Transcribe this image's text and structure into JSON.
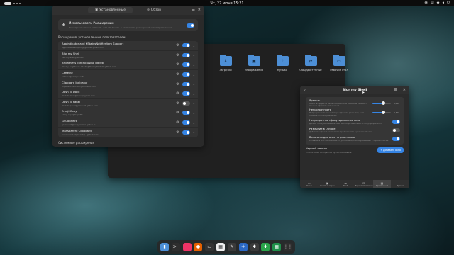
{
  "topbar": {
    "clock": "Чт, 27 июня 15:21"
  },
  "extensions_window": {
    "tabs": [
      {
        "label": "Установленные"
      },
      {
        "label": "Обзор"
      }
    ],
    "use_extensions": {
      "title": "Использовать Расширения",
      "subtitle": "Расширения можно включить или отключить в настройках расширений или в приложении…"
    },
    "user_section": "Расширения, установленные пользователем",
    "items": [
      {
        "title": "AppIndicator and KStatusNotifierItem Support",
        "subtitle": "appindicatorsupport@rgcjonas.gmail.com",
        "enabled": true
      },
      {
        "title": "Blur my Shell",
        "subtitle": "blur-my-shell@aunetx",
        "enabled": true
      },
      {
        "title": "Brightness control using ddcutil",
        "subtitle": "display-brightness-ddcutil@themightydeity.github.com",
        "enabled": true
      },
      {
        "title": "Caffeine",
        "subtitle": "caffeine@patapon.info",
        "enabled": true
      },
      {
        "title": "Clipboard Indicator",
        "subtitle": "clipboard-indicator@tudmotu.com",
        "enabled": true
      },
      {
        "title": "Dash to Dock",
        "subtitle": "dash-to-dock@micxgx.gmail.com",
        "enabled": true
      },
      {
        "title": "Dash to Panel",
        "subtitle": "dash-to-panel@jderose9.github.com",
        "enabled": false
      },
      {
        "title": "Emoji Copy",
        "subtitle": "emoji-copy@felipeftn",
        "enabled": true
      },
      {
        "title": "GSConnect",
        "subtitle": "gsconnect@andyholmes.github.io",
        "enabled": true
      },
      {
        "title": "Transparent Clipboard",
        "subtitle": "transparent-clipboard@...github.com",
        "enabled": true
      }
    ],
    "system_section": "Системные расширения"
  },
  "files_window": {
    "folders": [
      {
        "label": "Загрузки",
        "icon": "download-icon"
      },
      {
        "label": "Изображения",
        "icon": "image-icon"
      },
      {
        "label": "Музыка",
        "icon": "music-icon"
      },
      {
        "label": "Общедоступные",
        "icon": "share-icon"
      },
      {
        "label": "Рабочий стол",
        "icon": "desktop-icon"
      }
    ]
  },
  "blur_window": {
    "title": "Blur my Shell",
    "options": [
      {
        "title": "Яркость",
        "subtitle": "Яркость эффекта размытия, высокое значение означает меньше эффекта затемнения.",
        "control": "slider",
        "value": 0.6,
        "value_label": "0,60"
      },
      {
        "title": "Непрозрачность",
        "subtitle": "Непрозрачность окна поверх эффекта размытия, ноль означает только размытие.",
        "control": "slider",
        "value": 0.6,
        "value_label": "0,60"
      },
      {
        "title": "Непрозрачное сфокусированное окно",
        "subtitle": "Делает сфокусированное окно непрозрачным вместо полупрозрачного.",
        "control": "toggle",
        "enabled": true
      },
      {
        "title": "Размытие в Обзоре",
        "subtitle": "Добавить эффект размытия к приложениям в режиме Обзора.",
        "control": "toggle",
        "enabled": false
      },
      {
        "title": "Включить для всех по умолчанию",
        "subtitle": "Размывать все приложения по умолчанию, кроме указанных в черном списке.",
        "control": "toggle",
        "enabled": true
      }
    ],
    "blacklist": {
      "title": "Черный список",
      "subtitle": "Список окон, которые не нужно размывать.",
      "add_label": "+ Добавить окно"
    },
    "tabs": [
      {
        "label": "Панель",
        "icon": "panel-icon"
      },
      {
        "label": "Фоновый экран",
        "icon": "background-icon"
      },
      {
        "label": "Dash",
        "icon": "dash-icon"
      },
      {
        "label": "Экран блокировки",
        "icon": "lock-icon"
      },
      {
        "label": "Приложения",
        "icon": "apps-icon",
        "active": true
      },
      {
        "label": "Прочее",
        "icon": "other-icon"
      }
    ]
  },
  "dock": {
    "apps": [
      {
        "icon": "files-icon",
        "color": "#4d8fd6",
        "glyph": "▮"
      },
      {
        "icon": "terminal-icon",
        "color": "#2e2e2e",
        "glyph": ">_"
      },
      {
        "icon": "software-icon",
        "color": "#e36"
      },
      {
        "icon": "firefox-icon",
        "color": "#e66000",
        "glyph": "●"
      },
      {
        "icon": "terminal2-icon",
        "color": "#333",
        "glyph": "▭"
      },
      {
        "icon": "calendar-icon",
        "color": "#eee",
        "glyph": "▦"
      },
      {
        "icon": "pen-icon",
        "color": "#3a3a3a",
        "glyph": "✎"
      },
      {
        "icon": "extensions-icon",
        "color": "#2b68c4",
        "glyph": "✚"
      },
      {
        "icon": "puzzle-icon",
        "color": "#3a3a3a",
        "glyph": "✱"
      },
      {
        "icon": "green-app-icon",
        "color": "#2aa54a",
        "glyph": "✚"
      },
      {
        "icon": "calendar2-icon",
        "color": "#1f8f4a",
        "glyph": "▦"
      },
      {
        "icon": "app-grid-icon",
        "color": "#2e2e2e",
        "glyph": "⋮⋮"
      }
    ]
  }
}
